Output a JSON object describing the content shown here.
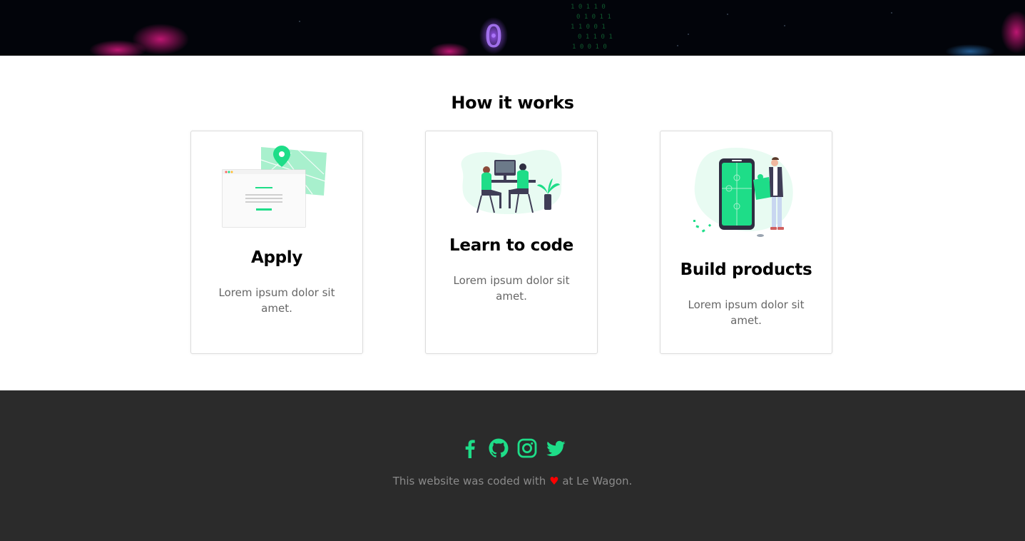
{
  "banner": {
    "image": "dark-code-background"
  },
  "how_it_works": {
    "title": "How it works",
    "cards": [
      {
        "illustration": "map-location-window-illustration",
        "title": "Apply",
        "text": "Lorem ipsum dolor sit amet."
      },
      {
        "illustration": "people-coding-at-desk-illustration",
        "title": "Learn to code",
        "text": "Lorem ipsum dolor sit amet."
      },
      {
        "illustration": "phone-puzzle-builder-illustration",
        "title": "Build products",
        "text": "Lorem ipsum dolor sit amet."
      }
    ]
  },
  "footer": {
    "social_icons": [
      "facebook-icon",
      "github-icon",
      "instagram-icon",
      "twitter-icon"
    ],
    "text_before": "This website was coded with",
    "heart": "♥",
    "text_after": "at Le Wagon."
  },
  "colors": {
    "accent": "#1edd88",
    "footer_bg": "#2b2b2b",
    "footer_text": "#8a8a8a",
    "heart": "#ff0000",
    "card_text": "#666666"
  }
}
